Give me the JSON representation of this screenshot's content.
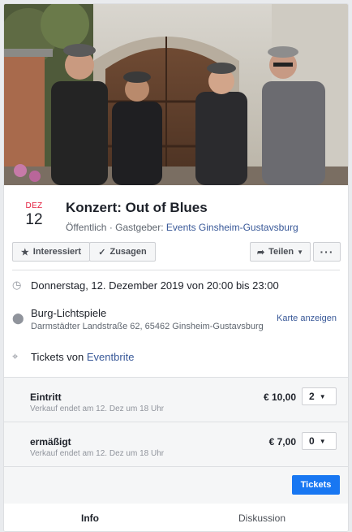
{
  "cover": {
    "alt": "Band photo"
  },
  "event": {
    "month": "DEZ",
    "day": "12",
    "title": "Konzert: Out of Blues",
    "visibility": "Öffentlich",
    "host_prefix": "Gastgeber:",
    "host": "Events Ginsheim-Gustavsburg"
  },
  "actions": {
    "interested": "Interessiert",
    "going": "Zusagen",
    "share": "Teilen",
    "more": "···"
  },
  "details": {
    "datetime": "Donnerstag, 12. Dezember 2019 von 20:00 bis 23:00",
    "location_name": "Burg-Lichtspiele",
    "location_address": "Darmstädter Landstraße 62, 65462 Ginsheim-Gustavsburg",
    "map_link": "Karte anzeigen",
    "tickets_prefix": "Tickets von",
    "tickets_provider": "Eventbrite"
  },
  "tickets": [
    {
      "name": "Eintritt",
      "sale_end": "Verkauf endet am 12. Dez um 18 Uhr",
      "price": "€ 10,00",
      "qty": "2"
    },
    {
      "name": "ermäßigt",
      "sale_end": "Verkauf endet am 12. Dez um 18 Uhr",
      "price": "€ 7,00",
      "qty": "0"
    }
  ],
  "buy_label": "Tickets",
  "tabs": [
    "Info",
    "Diskussion"
  ],
  "colors": {
    "accent": "#1877f2",
    "link": "#385898",
    "month": "#e41e3f"
  }
}
